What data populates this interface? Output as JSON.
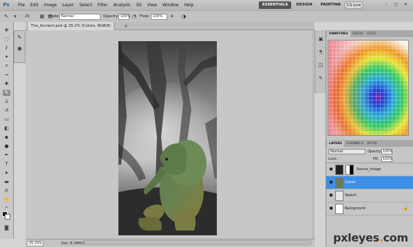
{
  "app": {
    "logo": "Ps",
    "menu": [
      "File",
      "Edit",
      "Image",
      "Layer",
      "Select",
      "Filter",
      "Analysis",
      "3D",
      "View",
      "Window",
      "Help"
    ],
    "workspaces": [
      "ESSENTIALS",
      "DESIGN",
      "PAINTING"
    ],
    "workspace_more": "»",
    "cs_live": "CS Live",
    "window_controls": [
      "–",
      "▢",
      "✕"
    ]
  },
  "options_bar": {
    "brush_size": "25",
    "mode_label": "Mode:",
    "mode_value": "Normal",
    "opacity_label": "Opacity:",
    "opacity_value": "100%",
    "flow_label": "Flow:",
    "flow_value": "100%"
  },
  "document": {
    "tab_title": "The_Ancient.psd @ 25.2% (Colors, RGB/8)",
    "close_glyph": "×",
    "zoom": "25.23%",
    "doc_info": "Doc: 8.29M/24.8M"
  },
  "panels": {
    "swatches_tabs": [
      "SWATCHES",
      "COLOR",
      "STYLE"
    ],
    "layers_tabs": [
      "LAYERS",
      "CHANNELS",
      "PATHS"
    ],
    "blend_mode": "Normal",
    "opacity_label": "Opacity:",
    "opacity_value": "100%",
    "lock_label": "Lock:",
    "fill_label": "Fill:",
    "fill_value": "100%",
    "layers": [
      {
        "name": "Source_Image",
        "selected": false,
        "has_mask": true
      },
      {
        "name": "Colors",
        "selected": true,
        "has_mask": false
      },
      {
        "name": "Sketch",
        "selected": false,
        "has_mask": false
      },
      {
        "name": "Background",
        "selected": false,
        "has_mask": false,
        "locked": true
      }
    ]
  },
  "watermark": {
    "prefix": "pxleyes",
    "dot": ".",
    "suffix": "com"
  },
  "colors": {
    "selection": "#3d8fe8",
    "panel": "#c6c6c6",
    "workspace_active": "#555555"
  }
}
